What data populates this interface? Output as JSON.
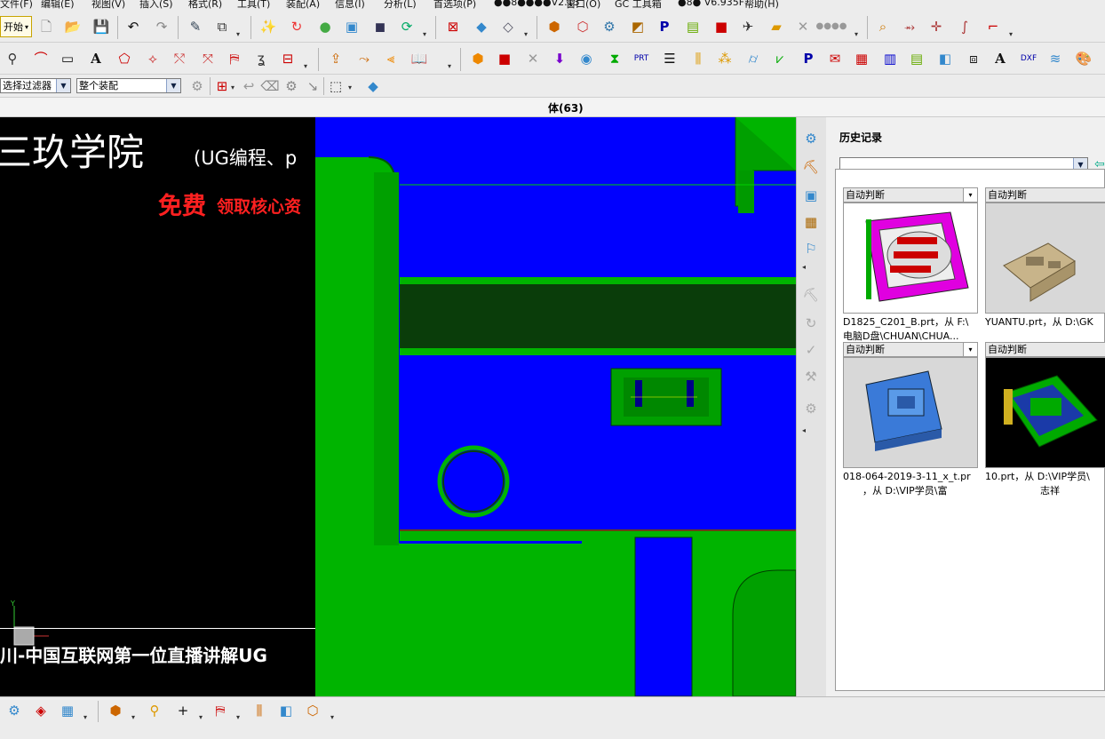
{
  "menu": [
    "文件(F)",
    "编辑(E)",
    "视图(V)",
    "插入(S)",
    "格式(R)",
    "工具(T)",
    "装配(A)",
    "信息(I)",
    "分析(L)",
    "首选项(P)",
    "●●8●●●●V2.13",
    "窗口(O)",
    "GC 工具箱",
    "●8● V6.935F",
    "帮助(H)"
  ],
  "toolbar": {
    "start_label": "开始",
    "selection_filter": "选择过滤器",
    "assembly_scope": "整个装配"
  },
  "window": {
    "title": "体(63)"
  },
  "left_overlay": {
    "school": "三玖学院",
    "school_sub": "(UG编程、p",
    "promo_red": "免费",
    "promo_rest": "领取核心资",
    "banner": "川-中国互联网第一位直播讲解UG"
  },
  "history": {
    "title": "历史记录",
    "search_value": "",
    "cards": [
      {
        "header": "自动判断",
        "caption1": "D1825_C201_B.prt，从 F:\\",
        "caption2": "电脑D盘\\CHUAN\\CHUA..."
      },
      {
        "header": "自动判断",
        "caption1": "YUANTU.prt，从 D:\\GK",
        "caption2": ""
      },
      {
        "header": "自动判断",
        "caption1": "018-064-2019-3-11_x_t.pr",
        "caption2": "，从 D:\\VIP学员\\富"
      },
      {
        "header": "自动判断",
        "caption1": "10.prt，从 D:\\VIP学员\\",
        "caption2": "志祥"
      }
    ]
  },
  "colors": {
    "model_blue": "#0000ff",
    "model_green": "#00b400",
    "dark_green": "#0a3d0a",
    "accent_red": "#ff2020"
  }
}
